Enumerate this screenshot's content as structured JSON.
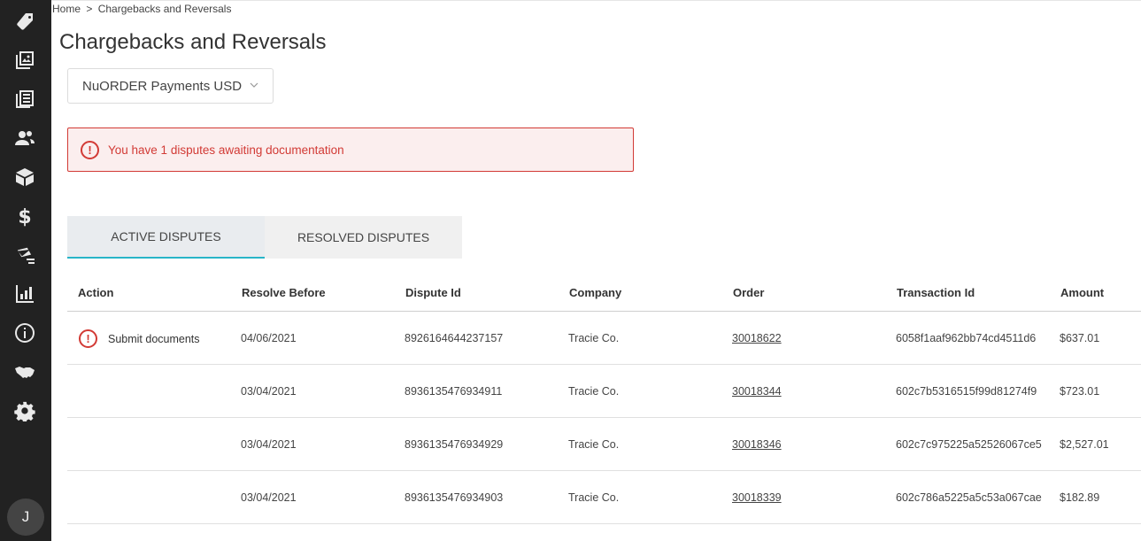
{
  "sidebar": {
    "items": [
      {
        "icon": "tag-icon"
      },
      {
        "icon": "image-catalog-icon"
      },
      {
        "icon": "orders-list-icon"
      },
      {
        "icon": "customers-icon"
      },
      {
        "icon": "box-icon"
      },
      {
        "icon": "dollar-icon"
      },
      {
        "icon": "messages-icon"
      },
      {
        "icon": "bar-chart-icon"
      },
      {
        "icon": "info-icon"
      },
      {
        "icon": "handshake-icon"
      },
      {
        "icon": "gear-icon"
      }
    ],
    "avatar_initial": "J"
  },
  "breadcrumb": {
    "home": "Home",
    "separator": ">",
    "current": "Chargebacks and Reversals"
  },
  "page_title": "Chargebacks and Reversals",
  "account_select": {
    "value": "NuORDER Payments USD"
  },
  "alert": {
    "icon": "!",
    "text": "You have 1 disputes awaiting documentation",
    "color": "#d23a35"
  },
  "tabs": [
    {
      "label": "ACTIVE DISPUTES",
      "active": true
    },
    {
      "label": "RESOLVED DISPUTES",
      "active": false
    }
  ],
  "accent_color": "#28b5c8",
  "table": {
    "headers": {
      "action": "Action",
      "resolve_before": "Resolve Before",
      "dispute_id": "Dispute Id",
      "company": "Company",
      "order": "Order",
      "transaction_id": "Transaction Id",
      "amount": "Amount"
    },
    "rows": [
      {
        "action": "Submit documents",
        "resolve_before": "04/06/2021",
        "dispute_id": "8926164644237157",
        "company": "Tracie Co.",
        "order": "30018622",
        "transaction_id": "6058f1aaf962bb74cd4511d6",
        "amount": "$637.01"
      },
      {
        "action": "",
        "resolve_before": "03/04/2021",
        "dispute_id": "8936135476934911",
        "company": "Tracie Co.",
        "order": "30018344",
        "transaction_id": "602c7b5316515f99d81274f9",
        "amount": "$723.01"
      },
      {
        "action": "",
        "resolve_before": "03/04/2021",
        "dispute_id": "8936135476934929",
        "company": "Tracie Co.",
        "order": "30018346",
        "transaction_id": "602c7c975225a52526067ce5",
        "amount": "$2,527.01"
      },
      {
        "action": "",
        "resolve_before": "03/04/2021",
        "dispute_id": "8936135476934903",
        "company": "Tracie Co.",
        "order": "30018339",
        "transaction_id": "602c786a5225a5c53a067cae",
        "amount": "$182.89"
      }
    ]
  }
}
